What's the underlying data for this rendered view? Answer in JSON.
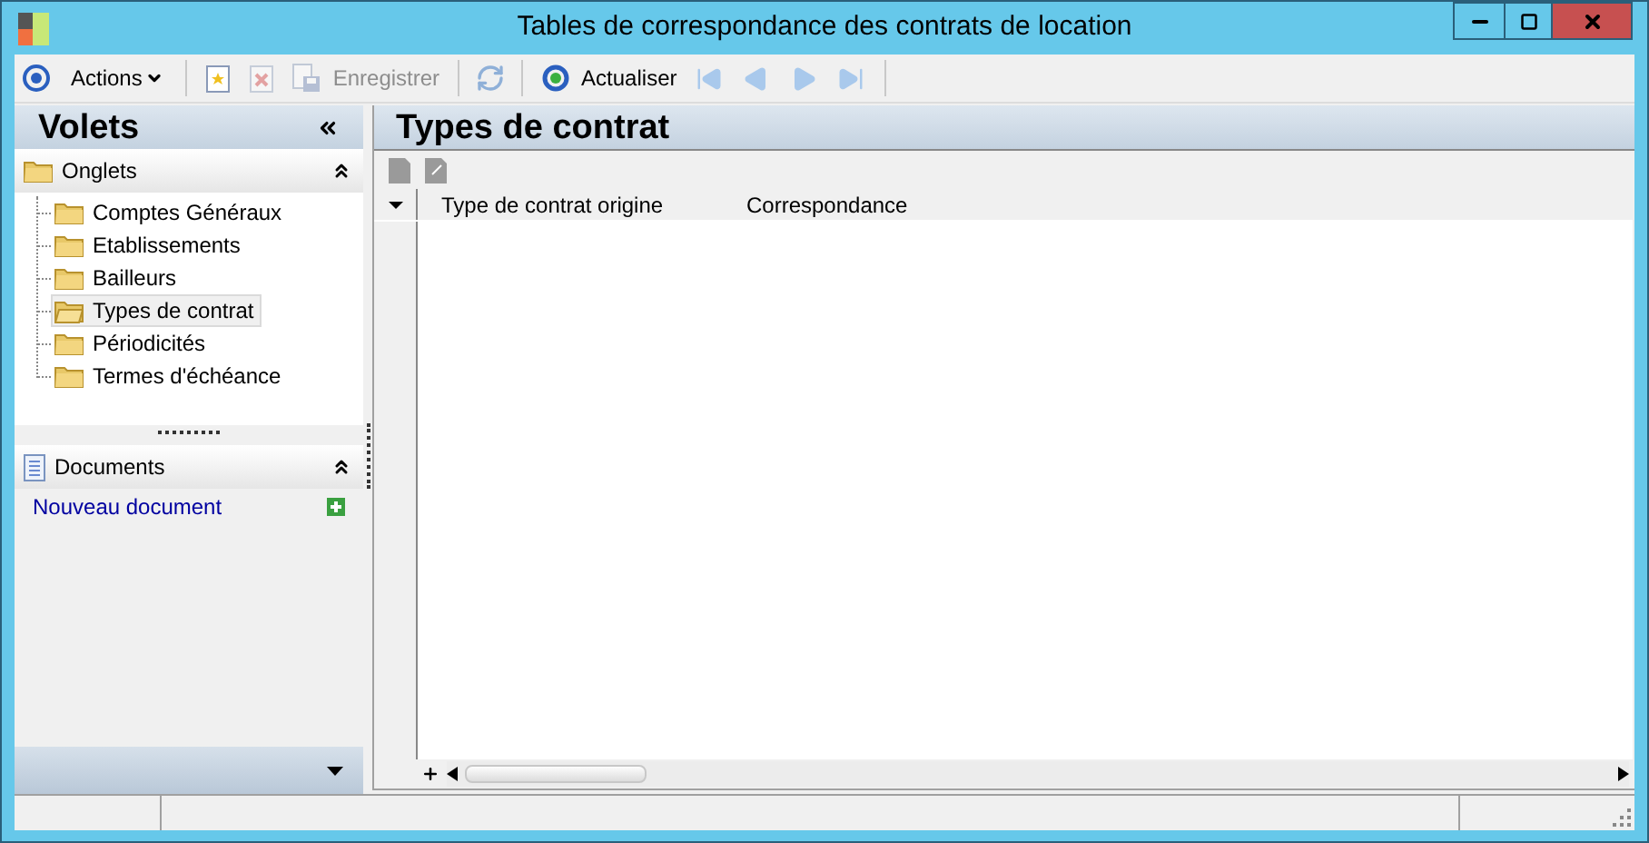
{
  "window": {
    "title": "Tables de correspondance des contrats de location"
  },
  "toolbar": [
    {
      "kind": "home",
      "disabled": false
    },
    {
      "kind": "menu",
      "label": "Actions",
      "disabled": false
    },
    {
      "kind": "separator"
    },
    {
      "kind": "new",
      "disabled": false
    },
    {
      "kind": "delete",
      "disabled": true
    },
    {
      "kind": "save",
      "label": "Enregistrer",
      "disabled": true
    },
    {
      "kind": "separator"
    },
    {
      "kind": "sync",
      "disabled": true
    },
    {
      "kind": "separator"
    },
    {
      "kind": "refresh",
      "label": "Actualiser",
      "disabled": false
    },
    {
      "kind": "first",
      "disabled": true
    },
    {
      "kind": "prev",
      "disabled": true
    },
    {
      "kind": "next",
      "disabled": true
    },
    {
      "kind": "last",
      "disabled": true
    },
    {
      "kind": "separator"
    }
  ],
  "sidebar": {
    "title": "Volets",
    "groups": [
      {
        "kind": "tree",
        "title": "Onglets",
        "expanded": true,
        "items": [
          {
            "label": "Comptes Généraux",
            "selected": false
          },
          {
            "label": "Etablissements",
            "selected": false
          },
          {
            "label": "Bailleurs",
            "selected": false
          },
          {
            "label": "Types de contrat",
            "selected": true
          },
          {
            "label": "Périodicités",
            "selected": false
          },
          {
            "label": "Termes d'échéance",
            "selected": false
          }
        ]
      },
      {
        "kind": "links",
        "title": "Documents",
        "expanded": true,
        "items": [
          {
            "label": "Nouveau document"
          }
        ]
      }
    ]
  },
  "content": {
    "title": "Types de contrat",
    "table": {
      "columns": [
        "Type de contrat origine",
        "Correspondance"
      ]
    }
  }
}
